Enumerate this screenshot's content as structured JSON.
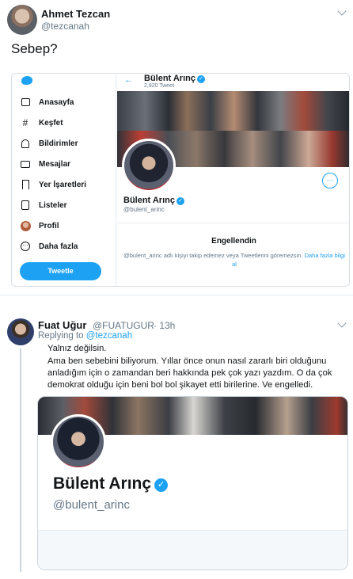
{
  "tweet1": {
    "author_name": "Ahmet Tezcan",
    "author_handle": "@tezcanah",
    "text": "Sebep?"
  },
  "embedded_screenshot": {
    "nav": [
      {
        "label": "Anasayfa",
        "icon": "home-icon"
      },
      {
        "label": "Keşfet",
        "icon": "hash-icon"
      },
      {
        "label": "Bildirimler",
        "icon": "bell-icon"
      },
      {
        "label": "Mesajlar",
        "icon": "mail-icon"
      },
      {
        "label": "Yer İşaretleri",
        "icon": "bookmark-icon"
      },
      {
        "label": "Listeler",
        "icon": "list-icon"
      },
      {
        "label": "Profil",
        "icon": "profile-icon"
      },
      {
        "label": "Daha fazla",
        "icon": "more-icon"
      }
    ],
    "tweet_button": "Tweetle",
    "profile": {
      "name": "Bülent Arınç",
      "tweet_count": "2,820 Tweet",
      "handle": "@bulent_arinc"
    },
    "blocked": {
      "title": "Engellendin",
      "description": "@bulent_arinc adlı kişiyi takip edemez veya Tweetlerini göremezsin.",
      "link": "Daha fazla bilgi al"
    }
  },
  "tweet2": {
    "author_name": "Fuat Uğur",
    "author_handle": "@FUATUGUR",
    "time": "· 13h",
    "replying_prefix": "Replying to",
    "replying_handle": "@tezcanah",
    "lines": [
      "Yalnız değilsin.",
      "Ama ben sebebini biliyorum. Yıllar önce onun nasıl zararlı biri olduğunu",
      "anladığım için o zamandan beri hakkında pek çok yazı yazdım. O da çok",
      "demokrat olduğu için beni bol bol şikayet etti birilerine. Ve engelledi."
    ],
    "card": {
      "name": "Bülent Arınç",
      "handle": "@bulent_arinc"
    }
  },
  "colors": {
    "accent": "#1da1f2",
    "muted": "#657786",
    "text": "#14171a"
  }
}
